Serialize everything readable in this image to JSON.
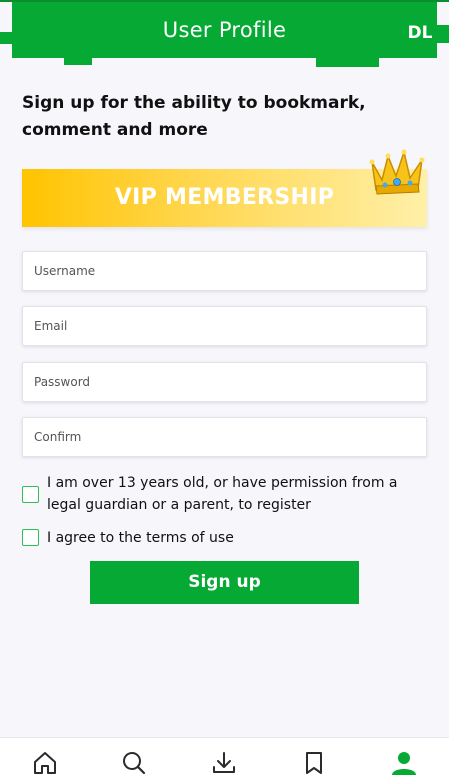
{
  "header": {
    "title": "User Profile",
    "badge": "DL"
  },
  "intro": {
    "text": "Sign up for the ability to bookmark, comment and more"
  },
  "vip": {
    "label": "VIP MEMBERSHIP",
    "icon": "crown-icon"
  },
  "form": {
    "username_placeholder": "Username",
    "email_placeholder": "Email",
    "password_placeholder": "Password",
    "confirm_placeholder": "Confirm",
    "age_label": "I am over 13 years old, or have permission from a legal guardian or a parent, to register",
    "terms_label": "I agree to the terms of use",
    "submit_label": "Sign up"
  },
  "nav": {
    "items": [
      {
        "icon": "home-icon"
      },
      {
        "icon": "search-icon"
      },
      {
        "icon": "download-icon"
      },
      {
        "icon": "bookmark-icon"
      },
      {
        "icon": "user-icon",
        "active": true
      }
    ]
  },
  "colors": {
    "brand_green": "#06a933",
    "vip_gold": "#ffc400",
    "background": "#f6f6fb",
    "checkbox_border": "#2ebf5a"
  }
}
